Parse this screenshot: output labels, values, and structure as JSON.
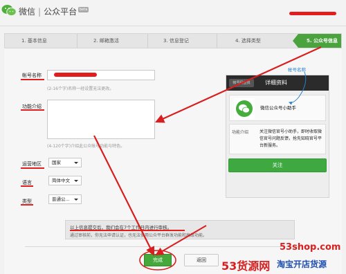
{
  "header": {
    "brand_name": "微信",
    "brand_separator": "|",
    "brand_subtitle": "公众平台",
    "beta_badge": "beta"
  },
  "steps": [
    {
      "label": "1. 基本信息",
      "active": false
    },
    {
      "label": "2. 邮箱激活",
      "active": false
    },
    {
      "label": "3. 信息登记",
      "active": false
    },
    {
      "label": "4. 选择类型",
      "active": false
    },
    {
      "label": "5. 公众号信息",
      "active": true
    }
  ],
  "form": {
    "account_name": {
      "label": "帐号名称",
      "hint": "(2-16个字)名称一经设置无法更改。"
    },
    "intro": {
      "label": "功能介绍",
      "hint": "(4-120个字)介绍此公众帐号功能与特色。"
    },
    "region": {
      "label": "运营地区",
      "value": "国家"
    },
    "language": {
      "label": "语言",
      "value": "简体中文"
    },
    "type": {
      "label": "类型",
      "value": "普通公..."
    }
  },
  "preview": {
    "back_label": "帐号码查找",
    "title": "详细资料",
    "account_name": "微信公众号小助手",
    "desc_label": "功能介绍",
    "desc_text": "关注微信官号小助手，即时收取微信官号问题反馈，抢先知晓官号平台新服务。",
    "follow_label": "关注",
    "callout": "帐号名称"
  },
  "notice": {
    "line1": "以上信息提交后，我们会在7个工作日内进行审核。",
    "line2": "通过审核前，你无法申请认证，也无法使用公众平台群发功能和高级功能。"
  },
  "buttons": {
    "done": "完成",
    "back": "返回"
  },
  "watermark": {
    "url": "53shop.com",
    "brand_a": "53货源网",
    "brand_b": "淘宝开店货源"
  },
  "colors": {
    "accent_green": "#45a83b",
    "annotation_red": "#e31c1c",
    "link_blue": "#2a80c9"
  },
  "icons": {
    "logo": "wechat-logo-icon",
    "avatar": "wechat-avatar-icon"
  }
}
